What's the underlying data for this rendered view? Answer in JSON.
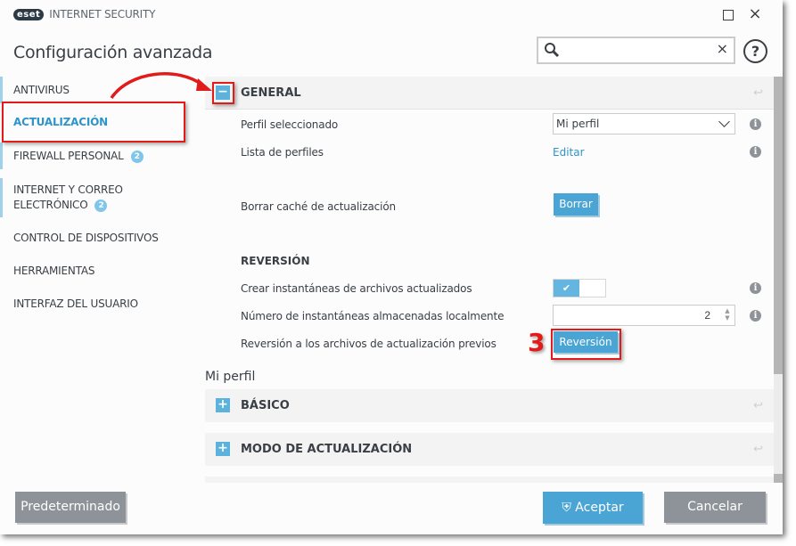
{
  "app": {
    "logo_badge": "eset",
    "product_name": "INTERNET SECURITY",
    "window_controls": {
      "maximize": "maximize-icon",
      "close": "×"
    }
  },
  "header": {
    "title": "Configuración avanzada",
    "search": {
      "value": "",
      "placeholder": "",
      "clear": "×"
    },
    "help": "?"
  },
  "sidebar": {
    "items": [
      {
        "label": "ANTIVIRUS",
        "badge": null,
        "active": false
      },
      {
        "label": "ACTUALIZACIÓN",
        "badge": null,
        "active": true
      },
      {
        "label": "FIREWALL PERSONAL",
        "badge": "2",
        "active": false
      },
      {
        "label": "INTERNET Y CORREO",
        "label2": "ELECTRÓNICO",
        "badge": "2",
        "active": false
      },
      {
        "label": "CONTROL DE DISPOSITIVOS",
        "badge": null,
        "active": false
      },
      {
        "label": "HERRAMIENTAS",
        "badge": null,
        "active": false
      },
      {
        "label": "INTERFAZ DEL USUARIO",
        "badge": null,
        "active": false
      }
    ]
  },
  "general": {
    "toggle": "−",
    "title": "GENERAL",
    "revert": "↩",
    "perfil_seleccionado": {
      "label": "Perfil seleccionado",
      "value": "Mi perfil"
    },
    "lista_perfiles": {
      "label": "Lista de perfiles",
      "link": "Editar"
    },
    "borrar_cache": {
      "label": "Borrar caché de actualización",
      "button": "Borrar"
    },
    "reversion": {
      "title": "REVERSIÓN",
      "crear_instantaneas": {
        "label": "Crear instantáneas de archivos actualizados",
        "enabled": true,
        "check": "✔"
      },
      "numero_instantaneas": {
        "label": "Número de instantáneas almacenadas localmente",
        "value": "2",
        "up": "▲",
        "down": "▼"
      },
      "reversion_previos": {
        "label": "Reversión a los archivos de actualización previos",
        "button": "Reversión"
      }
    }
  },
  "profile_section": {
    "label": "Mi perfil",
    "sections": [
      {
        "toggle": "+",
        "title": "BÁSICO",
        "revert": "↩"
      },
      {
        "toggle": "+",
        "title": "MODO DE ACTUALIZACIÓN",
        "revert": "↩"
      }
    ]
  },
  "info": "i",
  "annotation": {
    "step": "3",
    "color": "#e21a1a"
  },
  "footer": {
    "default_button": "Predeterminado",
    "accept_button": "Aceptar",
    "cancel_button": "Cancelar"
  },
  "colors": {
    "accent": "#4aa5d4",
    "active_nav": "#2e94c9",
    "gray_button": "#8d9399"
  }
}
